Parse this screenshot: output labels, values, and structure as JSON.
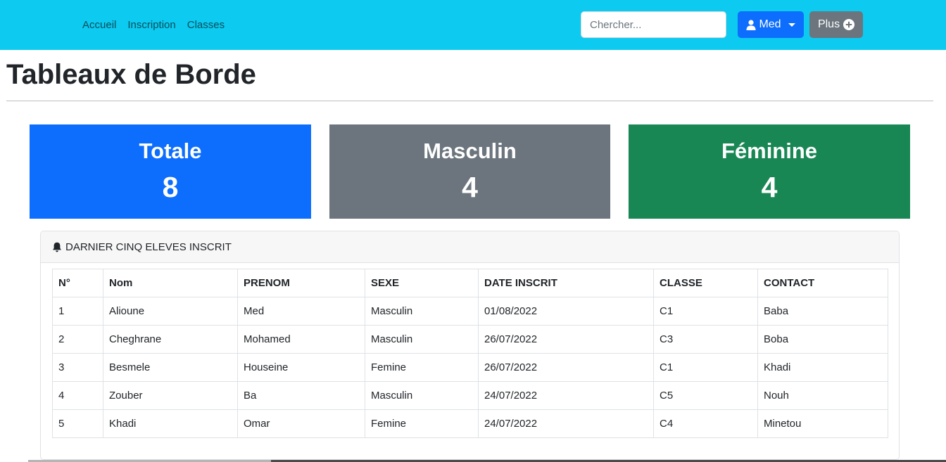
{
  "navbar": {
    "links": [
      {
        "label": "Accueil"
      },
      {
        "label": "Inscription"
      },
      {
        "label": "Classes"
      }
    ],
    "search": {
      "placeholder": "Chercher...",
      "value": ""
    },
    "user_button": {
      "label": "Med",
      "icon": "user-icon"
    },
    "plus_button": {
      "label": "Plus",
      "icon": "plus-circle-icon"
    }
  },
  "page": {
    "title": "Tableaux de Borde"
  },
  "stats": {
    "total": {
      "label": "Totale",
      "value": "8"
    },
    "male": {
      "label": "Masculin",
      "value": "4"
    },
    "female": {
      "label": "Féminine",
      "value": "4"
    }
  },
  "recent": {
    "header": "DARNIER CINQ ELEVES INSCRIT",
    "header_icon": "bell-icon",
    "columns": [
      "N°",
      "Nom",
      "PRENOM",
      "SEXE",
      "DATE INSCRIT",
      "CLASSE",
      "CONTACT"
    ],
    "rows": [
      [
        "1",
        "Alioune",
        "Med",
        "Masculin",
        "01/08/2022",
        "C1",
        "Baba"
      ],
      [
        "2",
        "Cheghrane",
        "Mohamed",
        "Masculin",
        "26/07/2022",
        "C3",
        "Boba"
      ],
      [
        "3",
        "Besmele",
        "Houseine",
        "Femine",
        "26/07/2022",
        "C1",
        "Khadi"
      ],
      [
        "4",
        "Zouber",
        "Ba",
        "Masculin",
        "24/07/2022",
        "C5",
        "Nouh"
      ],
      [
        "5",
        "Khadi",
        "Omar",
        "Femine",
        "24/07/2022",
        "C4",
        "Minetou"
      ]
    ]
  },
  "colors": {
    "navbar": "#0dcaf0",
    "primary": "#0d6efd",
    "secondary": "#6c757d",
    "success": "#198754"
  }
}
